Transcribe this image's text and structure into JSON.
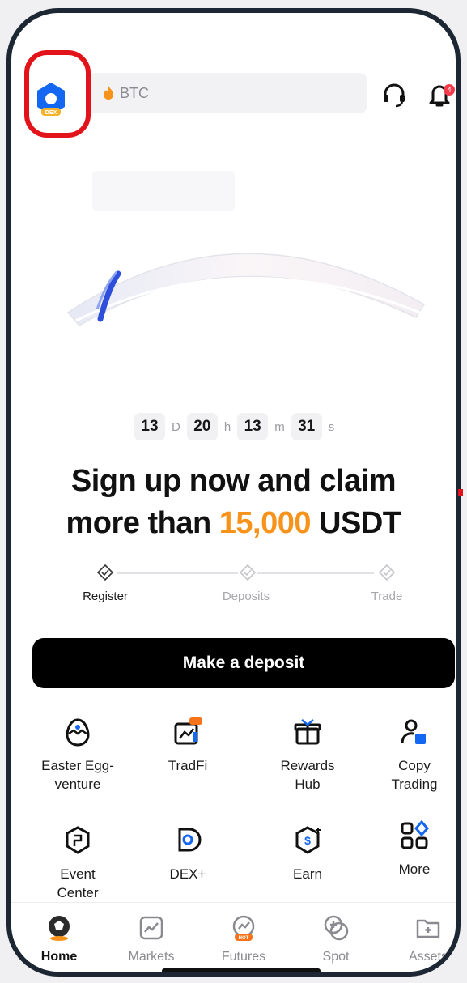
{
  "header": {
    "dex_badge": "DEX",
    "search_placeholder": "BTC",
    "notification_count": "4"
  },
  "countdown": {
    "days": "13",
    "days_unit": "D",
    "hours": "20",
    "hours_unit": "h",
    "minutes": "13",
    "minutes_unit": "m",
    "seconds": "31",
    "seconds_unit": "s"
  },
  "promo": {
    "line1": "Sign up now and claim",
    "line2_prefix": "more than ",
    "amount": "15,000",
    "currency": " USDT"
  },
  "steps": [
    {
      "label": "Register",
      "active": true
    },
    {
      "label": "Deposits",
      "active": false
    },
    {
      "label": "Trade",
      "active": false
    }
  ],
  "cta": {
    "label": "Make a deposit"
  },
  "shortcuts": [
    {
      "label_1": "Easter Egg-",
      "label_2": "venture",
      "icon": "egg-icon"
    },
    {
      "label_1": "TradFi",
      "label_2": "",
      "icon": "tradfi-icon",
      "badge": "Hot"
    },
    {
      "label_1": "Rewards",
      "label_2": "Hub",
      "icon": "gift-icon"
    },
    {
      "label_1": "Copy",
      "label_2": "Trading",
      "icon": "copy-trading-icon"
    },
    {
      "label_1": "Event",
      "label_2": "Center",
      "icon": "event-icon"
    },
    {
      "label_1": "DEX+",
      "label_2": "",
      "icon": "dex-icon"
    },
    {
      "label_1": "Earn",
      "label_2": "",
      "icon": "earn-icon"
    },
    {
      "label_1": "More",
      "label_2": "",
      "icon": "more-grid-icon"
    }
  ],
  "tabs": [
    {
      "label": "Home",
      "icon": "soccer-ball-icon",
      "active": true
    },
    {
      "label": "Markets",
      "icon": "chart-icon",
      "active": false
    },
    {
      "label": "Futures",
      "icon": "futures-icon",
      "active": false,
      "badge": "HOT"
    },
    {
      "label": "Spot",
      "icon": "coin-swap-icon",
      "active": false
    },
    {
      "label": "Assets",
      "icon": "folder-icon",
      "active": false
    }
  ],
  "colors": {
    "accent": "#f7931a",
    "brand_blue": "#1467f3",
    "highlight_red": "#e3131b"
  }
}
